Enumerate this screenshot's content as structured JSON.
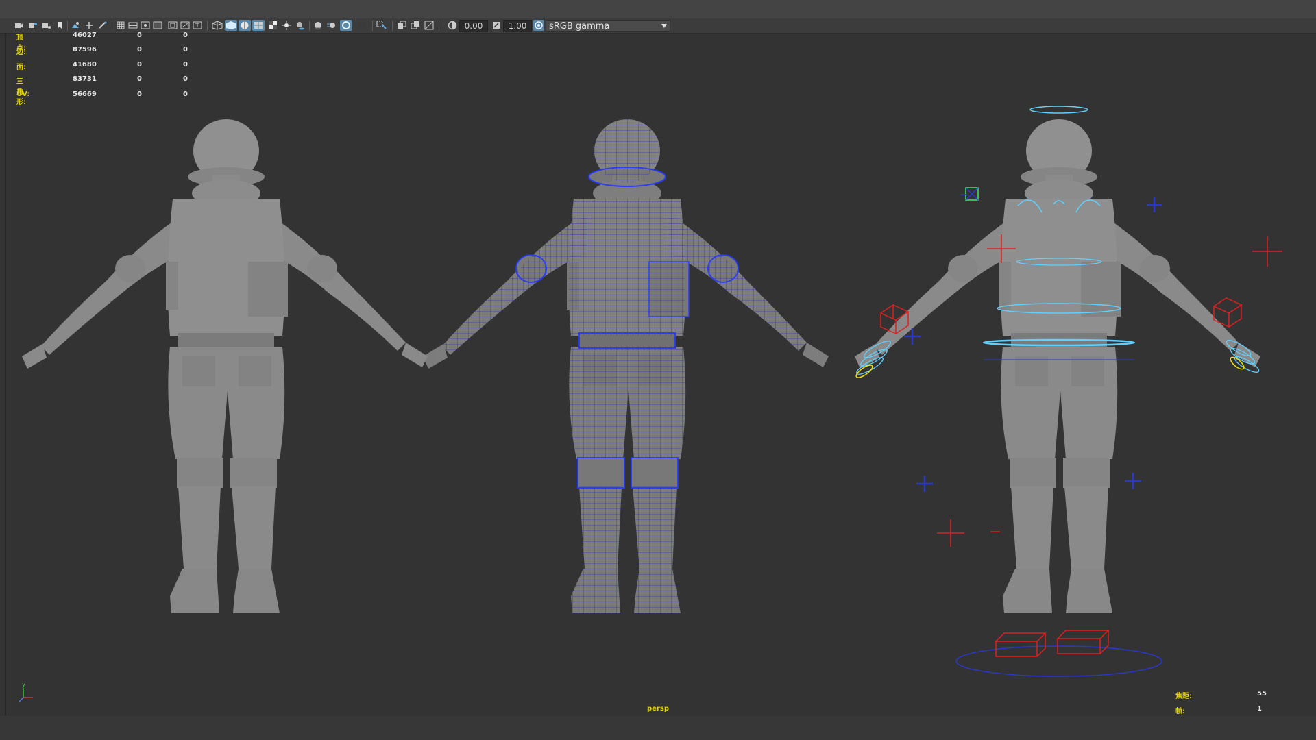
{
  "toolbar": {
    "exposure_value": "0.00",
    "gamma_value": "1.00",
    "color_space": "sRGB gamma",
    "icons": [
      "camera-icon",
      "camera-attr-icon",
      "bookmark-icon",
      "image-plane-icon",
      "grid-toggle-icon",
      "film-gate-icon",
      "resolution-gate-icon",
      "gate-mask-icon",
      "field-chart-icon",
      "safe-action-icon",
      "safe-title-icon",
      "wireframe-icon",
      "smooth-shade-icon",
      "textured-icon",
      "lights-icon",
      "shadows-icon",
      "ambient-occlusion-icon",
      "motion-blur-icon",
      "antialiasing-icon",
      "depth-of-field-icon",
      "isolate-select-icon",
      "xray-icon",
      "xray-joints-icon",
      "backface-icon",
      "exposure-icon",
      "gamma-icon",
      "view-transform-icon"
    ]
  },
  "hud": {
    "rows": [
      {
        "label": "顶点:",
        "total": "46027",
        "selected": "0",
        "components": "0"
      },
      {
        "label": "边:",
        "total": "87596",
        "selected": "0",
        "components": "0"
      },
      {
        "label": "面:",
        "total": "41680",
        "selected": "0",
        "components": "0"
      },
      {
        "label": "三角形:",
        "total": "83731",
        "selected": "0",
        "components": "0"
      },
      {
        "label": "UV:",
        "total": "56669",
        "selected": "0",
        "components": "0"
      }
    ],
    "focal_label": "焦距:",
    "focal_value": "55",
    "frame_label": "帧:",
    "frame_value": "1"
  },
  "viewport": {
    "camera": "persp",
    "background": "#333333",
    "models": [
      "soldier-shaded",
      "soldier-wireframe",
      "soldier-rigged"
    ]
  },
  "colors": {
    "hud_label": "#e2d400",
    "hud_value": "#e8e8e8",
    "wire": "#1f2fd0",
    "ctrl_cyan": "#5fd0ff",
    "ctrl_red": "#e02020",
    "ctrl_blue": "#2a38c8",
    "ctrl_yellow": "#f0e000"
  }
}
